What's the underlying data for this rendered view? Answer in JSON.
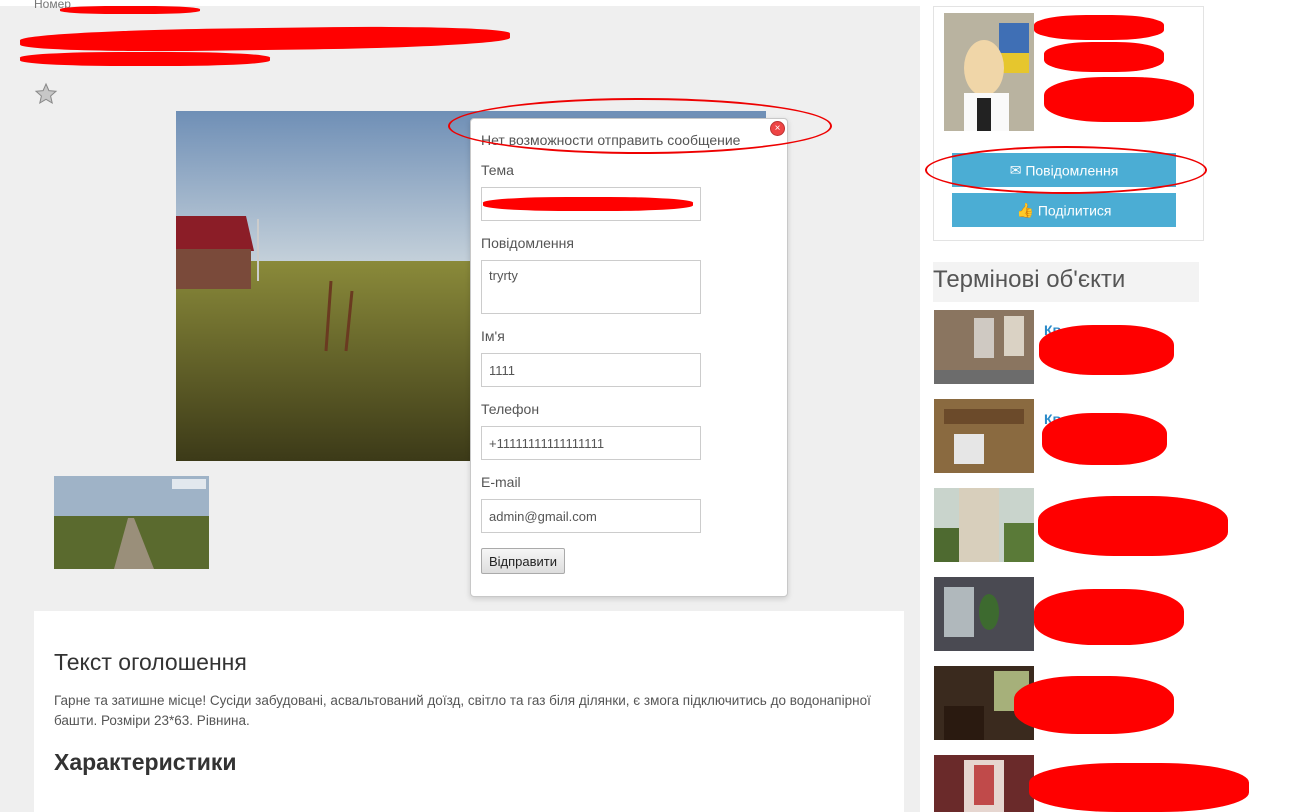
{
  "breadcrumb": "Номер",
  "modal": {
    "header": "Нет возможности отправить сообщение",
    "close_symbol": "×",
    "fields": {
      "subject_label": "Тема",
      "message_label": "Повідомлення",
      "message_value": "tryrty",
      "name_label": "Ім'я",
      "name_value": "1111",
      "phone_label": "Телефон",
      "phone_value": "+11111111111111111",
      "email_label": "E-mail",
      "email_value": "admin@gmail.com"
    },
    "submit_label": "Відправити"
  },
  "description": {
    "title": "Текст оголошення",
    "text": "Гарне та затишне місце! Сусіди забудовані, асвальтований доїзд, світло та газ біля ділянки, є змога підключитись до водонапірної башти. Розміри 23*63. Рівнина.",
    "characteristics_title": "Характеристики"
  },
  "sidebar": {
    "message_button": "Повідомлення",
    "message_icon": "envelope-icon",
    "share_button": "Поділитися",
    "share_icon": "thumbs-up-icon",
    "urgent_title": "Термінові об'єкти",
    "urgent_links": [
      "Кв",
      "Кв"
    ]
  },
  "colors": {
    "accent": "#4badd4",
    "annotation": "#ff0000"
  }
}
